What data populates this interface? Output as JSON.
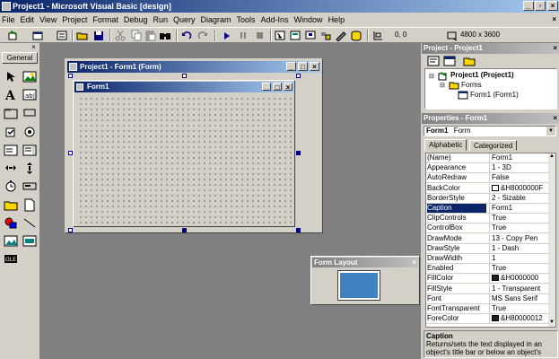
{
  "window": {
    "title": "Project1 - Microsoft Visual Basic [design]"
  },
  "menu": [
    "File",
    "Edit",
    "View",
    "Project",
    "Format",
    "Debug",
    "Run",
    "Query",
    "Diagram",
    "Tools",
    "Add-Ins",
    "Window",
    "Help"
  ],
  "toolbar": {
    "position": "0, 0",
    "size": "4800 x 3600"
  },
  "toolbox": {
    "tab": "General"
  },
  "designer": {
    "window_title": "Project1 - Form1 (Form)",
    "form_caption": "Form1"
  },
  "form_layout": {
    "title": "Form Layout"
  },
  "project_explorer": {
    "title": "Project - Project1",
    "nodes": [
      {
        "label": "Project1 (Project1)"
      },
      {
        "label": "Forms"
      },
      {
        "label": "Form1 (Form1)"
      }
    ]
  },
  "properties": {
    "title": "Properties - Form1",
    "object_name": "Form1",
    "object_type": "Form",
    "tabs": [
      "Alphabetic",
      "Categorized"
    ],
    "rows": [
      {
        "name": "(Name)",
        "value": "Form1"
      },
      {
        "name": "Appearance",
        "value": "1 - 3D"
      },
      {
        "name": "AutoRedraw",
        "value": "False"
      },
      {
        "name": "BackColor",
        "value": "&H8000000F",
        "swatch": "#ffffff"
      },
      {
        "name": "BorderStyle",
        "value": "2 - Sizable"
      },
      {
        "name": "Caption",
        "value": "Form1"
      },
      {
        "name": "ClipControls",
        "value": "True"
      },
      {
        "name": "ControlBox",
        "value": "True"
      },
      {
        "name": "DrawMode",
        "value": "13 - Copy Pen"
      },
      {
        "name": "DrawStyle",
        "value": "1 - Dash"
      },
      {
        "name": "DrawWidth",
        "value": "1"
      },
      {
        "name": "Enabled",
        "value": "True"
      },
      {
        "name": "FillColor",
        "value": "&H0000000",
        "swatch": "#202020"
      },
      {
        "name": "FillStyle",
        "value": "1 - Transparent"
      },
      {
        "name": "Font",
        "value": "MS Sans Serif"
      },
      {
        "name": "FontTransparent",
        "value": "True"
      },
      {
        "name": "ForeColor",
        "value": "&H80000012",
        "swatch": "#202020"
      }
    ],
    "selected_row": "Caption",
    "desc_title": "Caption",
    "desc_text": "Returns/sets the text displayed in an object's title bar or below an object's"
  },
  "colors": {
    "accent": "#0a246a",
    "face": "#d4d0c8",
    "mdi": "#808080"
  }
}
